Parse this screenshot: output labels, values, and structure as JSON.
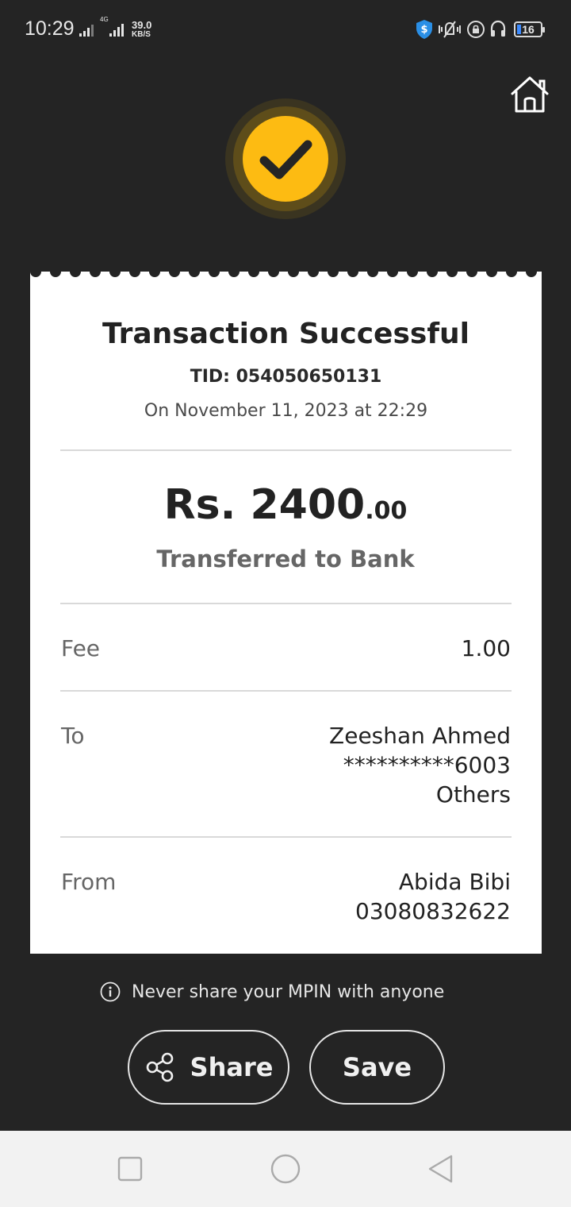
{
  "status_bar": {
    "time": "10:29",
    "network_type": "4G",
    "speed_value": "39.0",
    "speed_unit": "KB/S",
    "battery": "16",
    "icons": [
      "signal-icon",
      "shield-dollar-icon",
      "silent-bell-icon",
      "lock-rotation-icon",
      "headphones-icon",
      "battery-icon"
    ]
  },
  "header": {
    "home_icon": "home-icon",
    "status_icon": "check-icon"
  },
  "receipt": {
    "title": "Transaction Successful",
    "tid": "TID: 054050650131",
    "datetime": "On November 11, 2023 at 22:29",
    "amount_main": "Rs. 2400",
    "amount_decimal": ".00",
    "transfer_type": "Transferred to Bank",
    "fee": {
      "label": "Fee",
      "value": "1.00"
    },
    "to": {
      "label": "To",
      "name": "Zeeshan Ahmed",
      "account": "**********6003",
      "bank": "Others"
    },
    "from": {
      "label": "From",
      "name": "Abida Bibi",
      "number": "03080832622"
    }
  },
  "notice": "Never share your MPIN with anyone",
  "actions": {
    "share_label": "Share",
    "save_label": "Save"
  },
  "colors": {
    "background": "#242424",
    "accent": "#fdbb12",
    "card": "#ffffff"
  }
}
